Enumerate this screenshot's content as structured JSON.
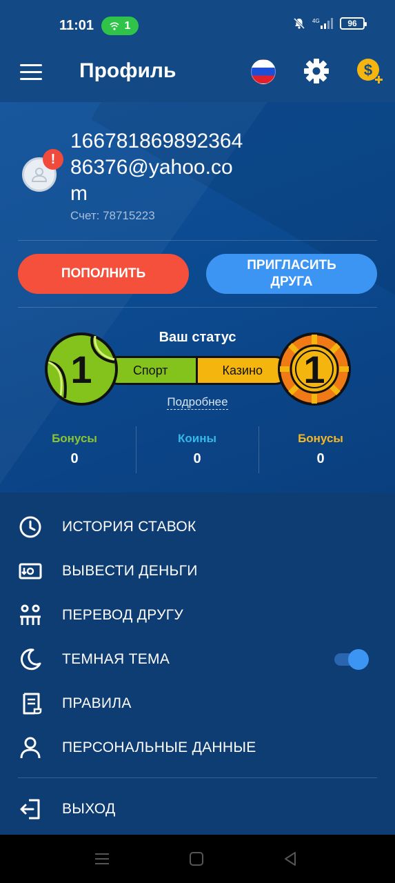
{
  "status_bar": {
    "time": "11:01",
    "hotspot_count": "1",
    "network": "4G",
    "battery": "96"
  },
  "header": {
    "title": "Профиль",
    "icons": [
      "menu-icon",
      "russia-flag-icon",
      "gear-icon",
      "coin-plus-icon"
    ]
  },
  "profile": {
    "email": "16678186989236486376@yahoo.com",
    "account_label": "Счет: 78715223",
    "alert_badge": "!"
  },
  "actions": {
    "deposit_label": "ПОПОЛНИТЬ",
    "invite_label": "ПРИГЛАСИТЬ ДРУГА"
  },
  "status": {
    "title": "Ваш статус",
    "sport_label": "Спорт",
    "casino_label": "Казино",
    "sport_level": "1",
    "casino_level": "1",
    "more_link": "Подробнее"
  },
  "stats": [
    {
      "label": "Бонусы",
      "value": "0",
      "color": "#8bc531"
    },
    {
      "label": "Коины",
      "value": "0",
      "color": "#35b8e8"
    },
    {
      "label": "Бонусы",
      "value": "0",
      "color": "#f4b825"
    }
  ],
  "menu": {
    "items": [
      {
        "label": "ИСТОРИЯ СТАВОК",
        "icon": "clock-history-icon"
      },
      {
        "label": "ВЫВЕСТИ ДЕНЬГИ",
        "icon": "withdraw-money-icon"
      },
      {
        "label": "ПЕРЕВОД ДРУГУ",
        "icon": "transfer-friend-icon"
      },
      {
        "label": "ТЕМНАЯ ТЕМА",
        "icon": "moon-icon",
        "toggle_on": true
      },
      {
        "label": "ПРАВИЛА",
        "icon": "rules-document-icon"
      },
      {
        "label": "ПЕРСОНАЛЬНЫЕ ДАННЫЕ",
        "icon": "user-icon"
      }
    ],
    "logout_label": "ВЫХОД"
  },
  "colors": {
    "deposit": "#f4503b",
    "invite": "#3d95f3",
    "sport": "#84c21c",
    "casino": "#f4b50e",
    "background": "#0e3d74"
  }
}
